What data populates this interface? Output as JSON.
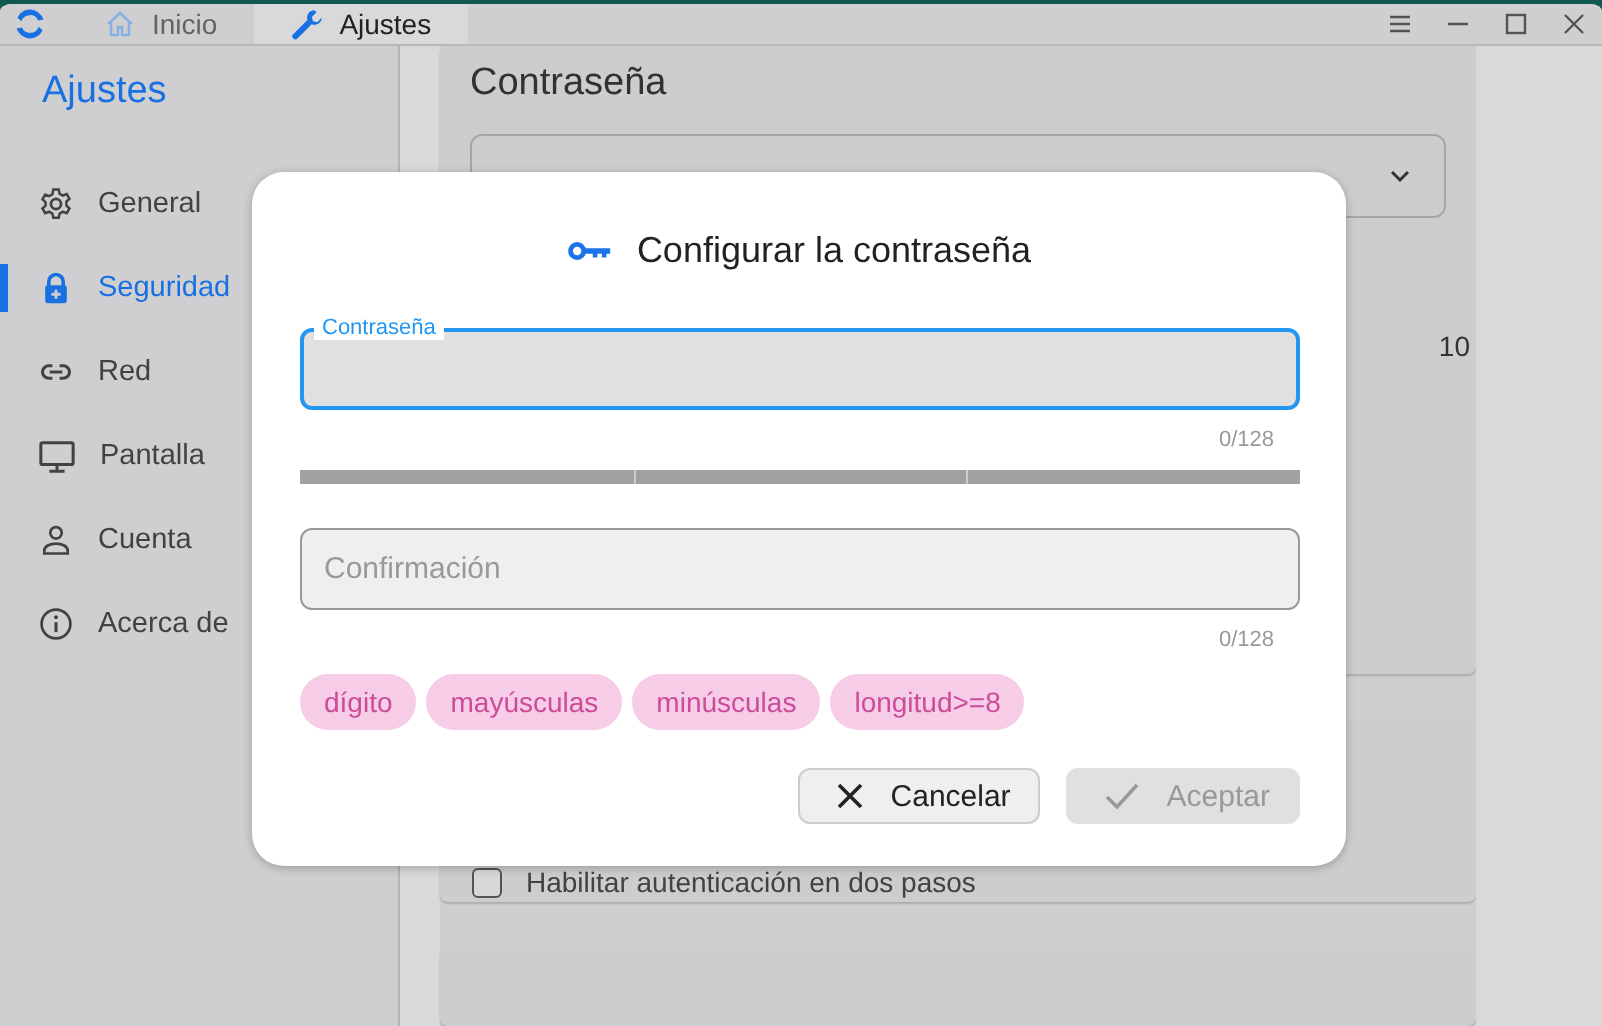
{
  "window": {
    "tabs": [
      {
        "label": "Inicio",
        "selected": false
      },
      {
        "label": "Ajustes",
        "selected": true
      }
    ]
  },
  "sidebar": {
    "title": "Ajustes",
    "items": [
      {
        "label": "General",
        "selected": false
      },
      {
        "label": "Seguridad",
        "selected": true
      },
      {
        "label": "Red",
        "selected": false
      },
      {
        "label": "Pantalla",
        "selected": false
      },
      {
        "label": "Cuenta",
        "selected": false
      },
      {
        "label": "Acerca de",
        "selected": false
      }
    ]
  },
  "content": {
    "heading": "Contraseña",
    "side_text": "10",
    "two_step": {
      "label": "Habilitar autenticación en dos pasos",
      "checked": false
    }
  },
  "dialog": {
    "title": "Configurar la contraseña",
    "fields": [
      {
        "label": "Contraseña",
        "focused": true,
        "counter": "0/128"
      },
      {
        "placeholder": "Confirmación",
        "focused": false,
        "counter": "0/128"
      }
    ],
    "chips": [
      "dígito",
      "mayúsculas",
      "minúsculas",
      "longitud>=8"
    ],
    "buttons": [
      {
        "label": "Cancelar",
        "kind": "cancel",
        "disabled": false
      },
      {
        "label": "Aceptar",
        "kind": "accept",
        "disabled": true
      }
    ]
  }
}
